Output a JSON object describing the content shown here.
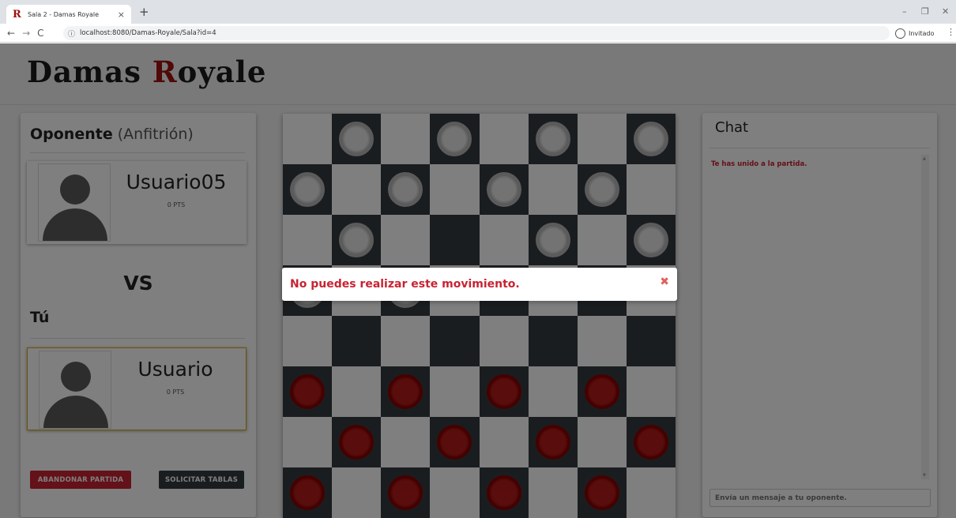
{
  "browser": {
    "tab_title": "Sala 2 - Damas Royale",
    "tab_favicon": "R",
    "tab_close": "×",
    "new_tab": "+",
    "url": "localhost:8080/Damas-Royale/Sala?id=4",
    "profile": "Invitado",
    "minimize": "–",
    "restore": "❐",
    "close": "✕",
    "back": "←",
    "forward": "→",
    "reload": "C",
    "menu": "⋮",
    "info": "ⓘ"
  },
  "brand": {
    "part1": "Damas ",
    "r": "R",
    "part2": "oyale"
  },
  "opponent": {
    "title": "Oponente",
    "subtitle": "(Anfitrión)",
    "name": "Usuario05",
    "points": "0 PTS"
  },
  "vs": "VS",
  "me": {
    "title": "Tú",
    "name": "Usuario",
    "points": "0 PTS"
  },
  "buttons": {
    "abandon": "ABANDONAR PARTIDA",
    "draw": "SOLICITAR TABLAS"
  },
  "chat": {
    "title": "Chat",
    "messages": [
      "Te has unido a la partida."
    ],
    "input_placeholder": "Envía un mensaje a tu oponente."
  },
  "alert": {
    "message": "No puedes realizar este movimiento.",
    "close": "✖"
  },
  "board": {
    "size": 8,
    "pieces": [
      [
        null,
        "white",
        null,
        "white",
        null,
        "white",
        null,
        "white"
      ],
      [
        "white",
        null,
        "white",
        null,
        "white",
        null,
        "white",
        null
      ],
      [
        null,
        "white",
        null,
        null,
        null,
        "white",
        null,
        "white"
      ],
      [
        "white",
        null,
        "white",
        null,
        null,
        null,
        null,
        null
      ],
      [
        null,
        null,
        null,
        null,
        null,
        null,
        null,
        null
      ],
      [
        "red",
        null,
        "red",
        null,
        "red",
        null,
        "red",
        null
      ],
      [
        null,
        "red",
        null,
        "red",
        null,
        "red",
        null,
        "red"
      ],
      [
        "red",
        null,
        "red",
        null,
        "red",
        null,
        "red",
        null
      ]
    ],
    "colors": {
      "dark": "#343a40",
      "light": "#ffffff",
      "red": "#b51a1a",
      "white": "#e6e6e6"
    }
  },
  "colors": {
    "accent": "#c82333",
    "brand_r": "#a01010"
  }
}
